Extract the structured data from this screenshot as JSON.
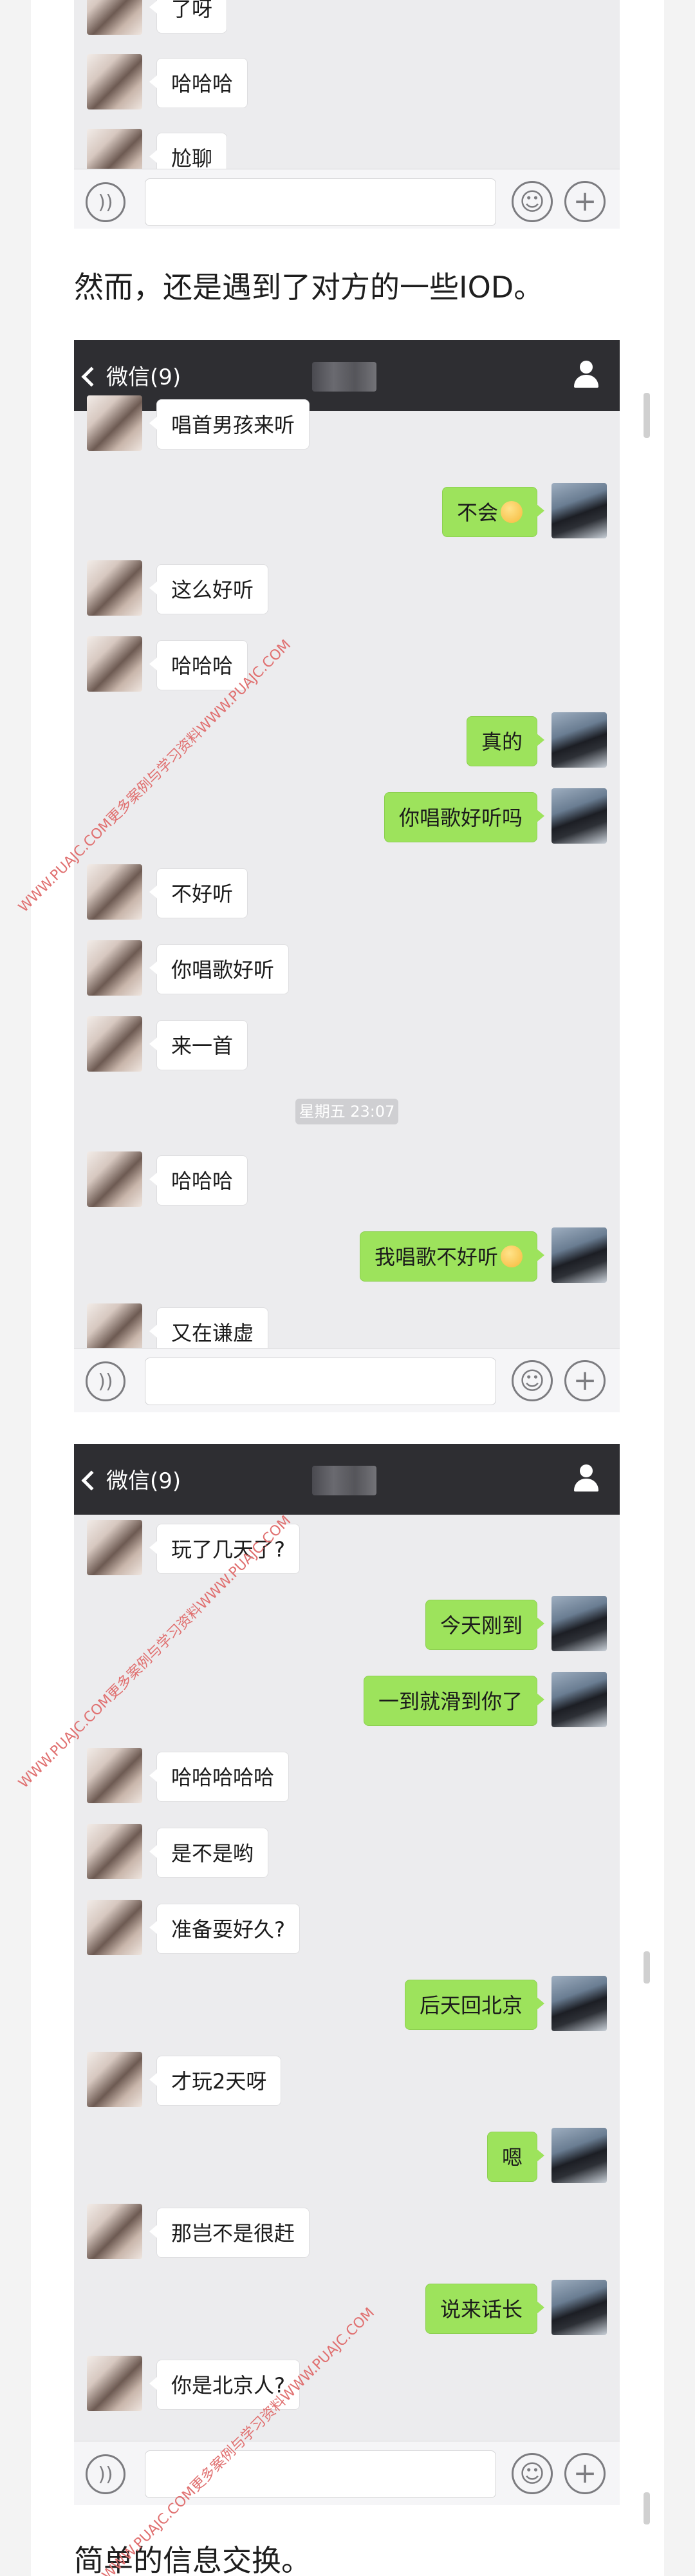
{
  "screenshot1": {
    "messages": [
      {
        "side": "left",
        "text": "了呀"
      },
      {
        "side": "left",
        "text": "哈哈哈"
      },
      {
        "side": "left",
        "text": "尬聊"
      }
    ]
  },
  "caption1": "然而，还是遇到了对方的一些IOD。",
  "screenshot2": {
    "back_label": "微信(9)",
    "timestamp": "星期五 23:07",
    "messages": [
      {
        "side": "left",
        "text": "唱首男孩来听"
      },
      {
        "side": "right",
        "text": "不会",
        "emoji": "smile-emoji"
      },
      {
        "side": "left",
        "text": "这么好听"
      },
      {
        "side": "left",
        "text": "哈哈哈"
      },
      {
        "side": "right",
        "text": "真的"
      },
      {
        "side": "right",
        "text": "你唱歌好听吗"
      },
      {
        "side": "left",
        "text": "不好听"
      },
      {
        "side": "left",
        "text": "你唱歌好听"
      },
      {
        "side": "left",
        "text": "来一首"
      },
      {
        "side": "left",
        "text": "哈哈哈"
      },
      {
        "side": "right",
        "text": "我唱歌不好听",
        "emoji": "smile-emoji"
      },
      {
        "side": "left",
        "text": "又在谦虚"
      }
    ]
  },
  "screenshot3": {
    "back_label": "微信(9)",
    "messages": [
      {
        "side": "left",
        "text": "玩了几天了?"
      },
      {
        "side": "right",
        "text": "今天刚到"
      },
      {
        "side": "right",
        "text": "一到就滑到你了"
      },
      {
        "side": "left",
        "text": "哈哈哈哈哈"
      },
      {
        "side": "left",
        "text": "是不是哟"
      },
      {
        "side": "left",
        "text": "准备耍好久?"
      },
      {
        "side": "right",
        "text": "后天回北京"
      },
      {
        "side": "left",
        "text": "才玩2天呀"
      },
      {
        "side": "right",
        "text": "嗯"
      },
      {
        "side": "left",
        "text": "那岂不是很赶"
      },
      {
        "side": "right",
        "text": "说来话长"
      },
      {
        "side": "left",
        "text": "你是北京人?"
      }
    ]
  },
  "caption2": "简单的信息交换。",
  "watermark": "WWW.PUAJC.COM更多案例与学习资料WWW.PUAJC.COM",
  "icons": {
    "back": "chevron-left-icon",
    "contact": "person-icon",
    "voice": "voice-icon",
    "emoji": "emoji-icon",
    "add": "plus-icon"
  },
  "colors": {
    "titlebar": "#2e2e32",
    "chat_background": "#ececee",
    "sent_bubble": "#9de35c",
    "received_bubble": "#ffffff"
  }
}
